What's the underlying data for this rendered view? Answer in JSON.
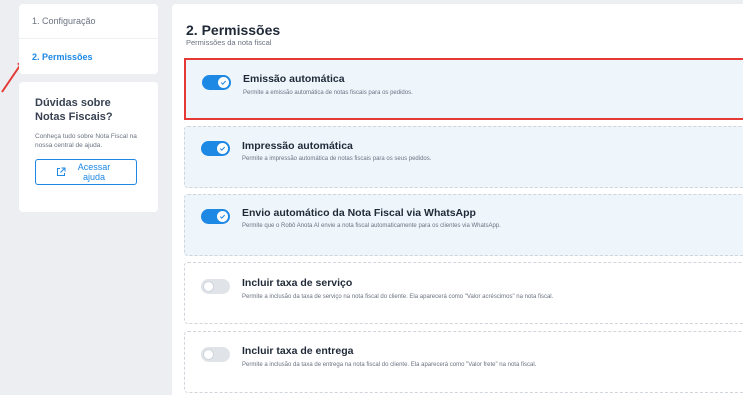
{
  "nav": {
    "items": [
      {
        "label": "1. Configuração"
      },
      {
        "label": "2. Permissões"
      }
    ]
  },
  "help": {
    "title": "Dúvidas sobre Notas Fiscais?",
    "text": "Conheça tudo sobre Nota Fiscal na nossa central de ajuda.",
    "button_label": "Acessar ajuda",
    "button_icon": "external-link-icon"
  },
  "main": {
    "title": "2. Permissões",
    "subtitle": "Permissões da nota fiscal"
  },
  "permissions": [
    {
      "title": "Emissão automática",
      "description": "Permite a emissão automática de notas fiscais para os pedidos.",
      "enabled": true
    },
    {
      "title": "Impressão automática",
      "description": "Permite a impressão automática de notas fiscais para os seus pedidos.",
      "enabled": true
    },
    {
      "title": "Envio automático da Nota Fiscal via WhatsApp",
      "description": "Permite que o Robô Anota AI envie a nota fiscal automaticamente para os clientes via WhatsApp.",
      "enabled": true
    },
    {
      "title": "Incluir taxa de serviço",
      "description": "Permite a inclusão da taxa de serviço na nota fiscal do cliente. Ela aparecerá como \"Valor acréscimos\" na nota fiscal.",
      "enabled": false
    },
    {
      "title": "Incluir taxa de entrega",
      "description": "Permite a inclusão da taxa de entrega na nota fiscal do cliente. Ela aparecerá como \"Valor frete\" na nota fiscal.",
      "enabled": false
    }
  ],
  "colors": {
    "accent": "#1e88e5",
    "highlight": "#e53935",
    "card_on_bg": "#eef6fc",
    "page_bg": "#eceef1"
  }
}
